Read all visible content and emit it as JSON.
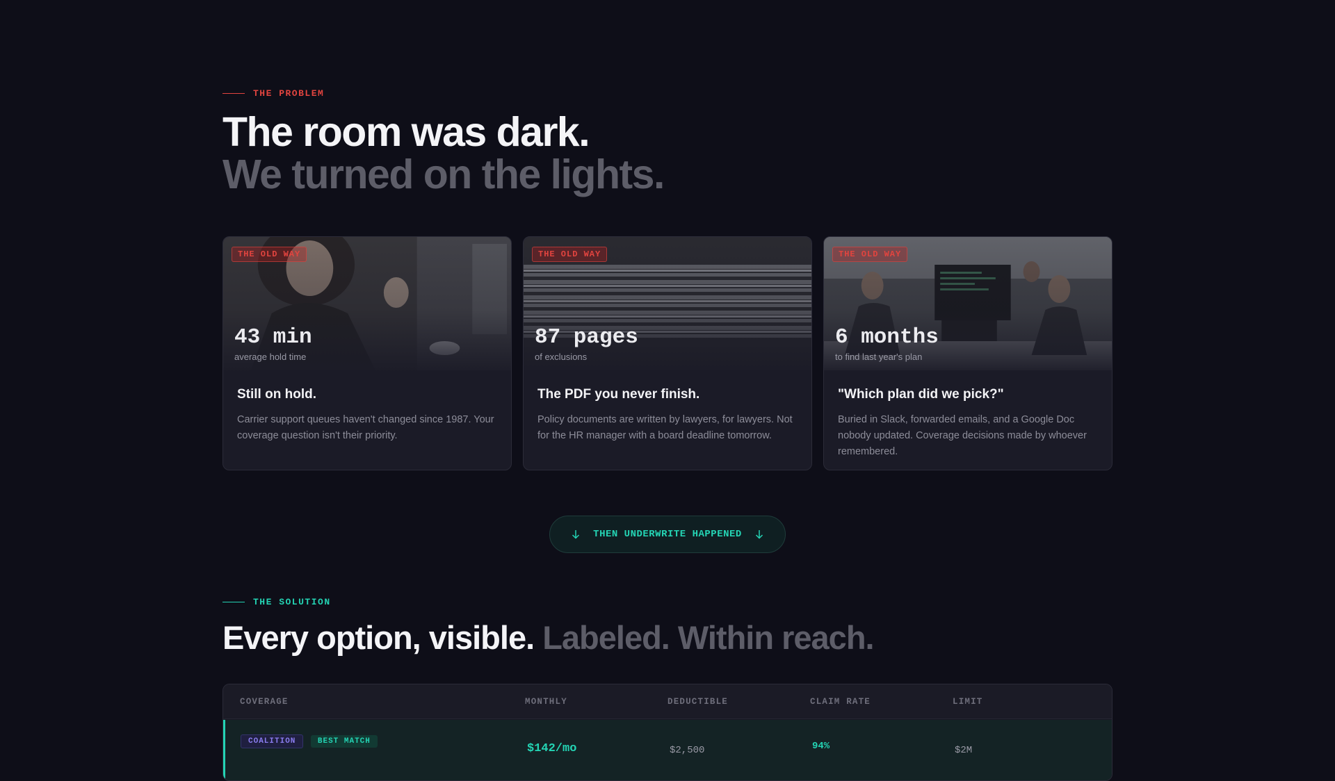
{
  "problem": {
    "eyebrow": "THE PROBLEM",
    "headline_line1": "The room was dark.",
    "headline_line2": "We turned on the lights."
  },
  "cards": [
    {
      "badge": "THE OLD WAY",
      "stat": "43 min",
      "stat_label": "average hold time",
      "title": "Still on hold.",
      "text": "Carrier support queues haven't changed since 1987. Your coverage question isn't their priority."
    },
    {
      "badge": "THE OLD WAY",
      "stat": "87 pages",
      "stat_label": "of exclusions",
      "title": "The PDF you never finish.",
      "text": "Policy documents are written by lawyers, for lawyers. Not for the HR manager with a board deadline tomorrow."
    },
    {
      "badge": "THE OLD WAY",
      "stat": "6 months",
      "stat_label": "to find last year's plan",
      "title": "\"Which plan did we pick?\"",
      "text": "Buried in Slack, forwarded emails, and a Google Doc nobody updated. Coverage decisions made by whoever remembered."
    }
  ],
  "transition": {
    "label": "THEN UNDERWRITE HAPPENED"
  },
  "solution": {
    "eyebrow": "THE SOLUTION",
    "headline_a": "Every option, visible.",
    "headline_b": "Labeled. Within reach."
  },
  "table": {
    "headers": [
      "COVERAGE",
      "MONTHLY",
      "DEDUCTIBLE",
      "CLAIM RATE",
      "LIMIT"
    ],
    "rows": [
      {
        "carrier": "COALITION",
        "tag": "BEST MATCH",
        "monthly": "$142/mo",
        "deductible": "$2,500",
        "claim_rate": "94%",
        "limit": "$2M"
      }
    ]
  },
  "colors": {
    "background": "#0e0e18",
    "accent_red": "#e2443f",
    "accent_teal": "#24d4b4",
    "muted_text": "#5d5d68"
  }
}
